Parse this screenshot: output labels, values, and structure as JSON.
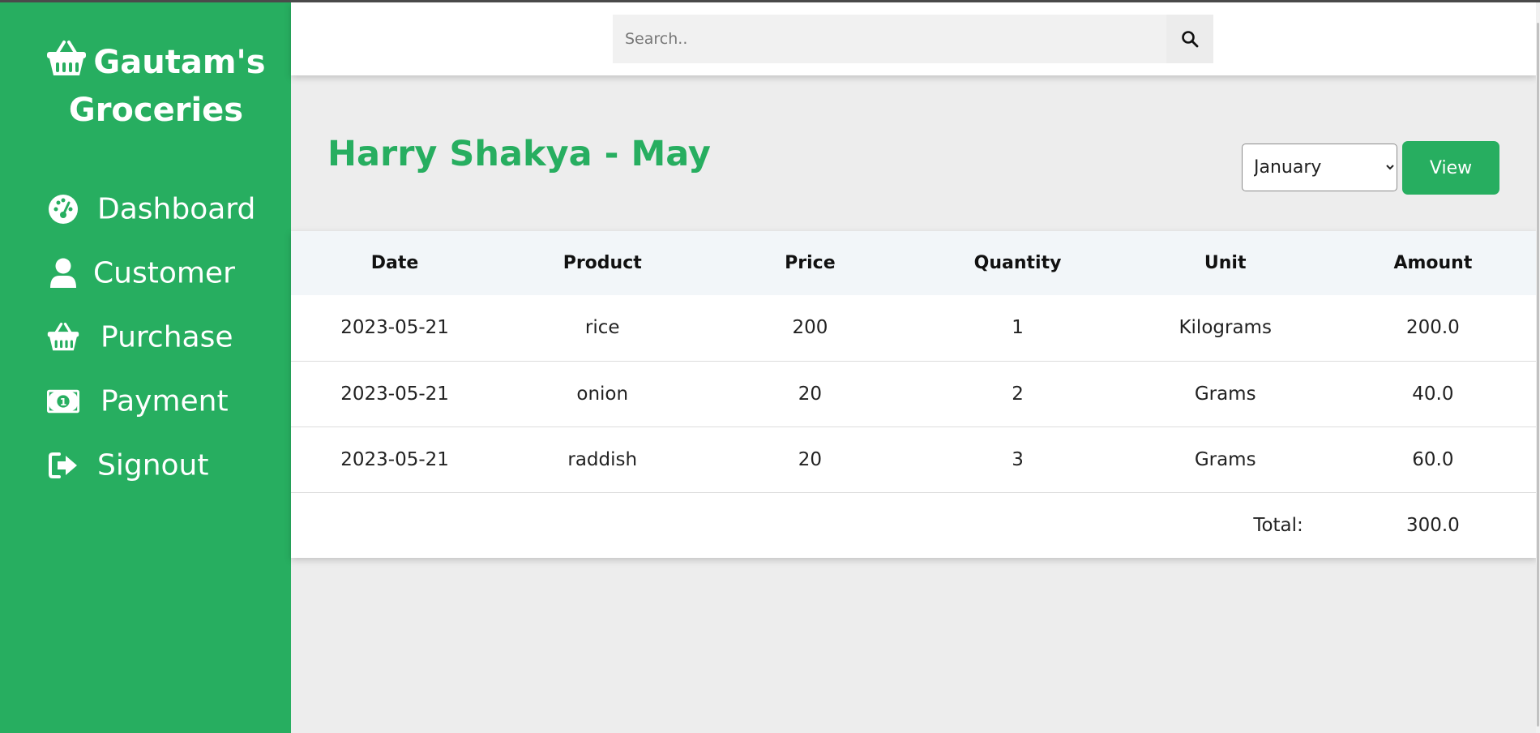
{
  "brand": {
    "title_line1": "Gautam's",
    "title_line2": "Groceries",
    "icon": "basket-icon"
  },
  "colors": {
    "accent": "#27ae60",
    "page_bg": "#ededed",
    "header_row_bg": "#f2f6f9"
  },
  "sidebar": {
    "items": [
      {
        "label": "Dashboard",
        "icon": "dashboard-icon"
      },
      {
        "label": "Customer",
        "icon": "user-icon"
      },
      {
        "label": "Purchase",
        "icon": "basket-icon"
      },
      {
        "label": "Payment",
        "icon": "money-bill-icon"
      },
      {
        "label": "Signout",
        "icon": "sign-out-icon"
      }
    ]
  },
  "search": {
    "placeholder": "Search..",
    "value": ""
  },
  "page": {
    "heading": "Harry Shakya - May"
  },
  "filter": {
    "selected_month": "January",
    "view_label": "View"
  },
  "table": {
    "headers": [
      "Date",
      "Product",
      "Price",
      "Quantity",
      "Unit",
      "Amount"
    ],
    "rows": [
      [
        "2023-05-21",
        "rice",
        "200",
        "1",
        "Kilograms",
        "200.0"
      ],
      [
        "2023-05-21",
        "onion",
        "20",
        "2",
        "Grams",
        "40.0"
      ],
      [
        "2023-05-21",
        "raddish",
        "20",
        "3",
        "Grams",
        "60.0"
      ]
    ],
    "total_label": "Total:",
    "total_value": "300.0"
  }
}
